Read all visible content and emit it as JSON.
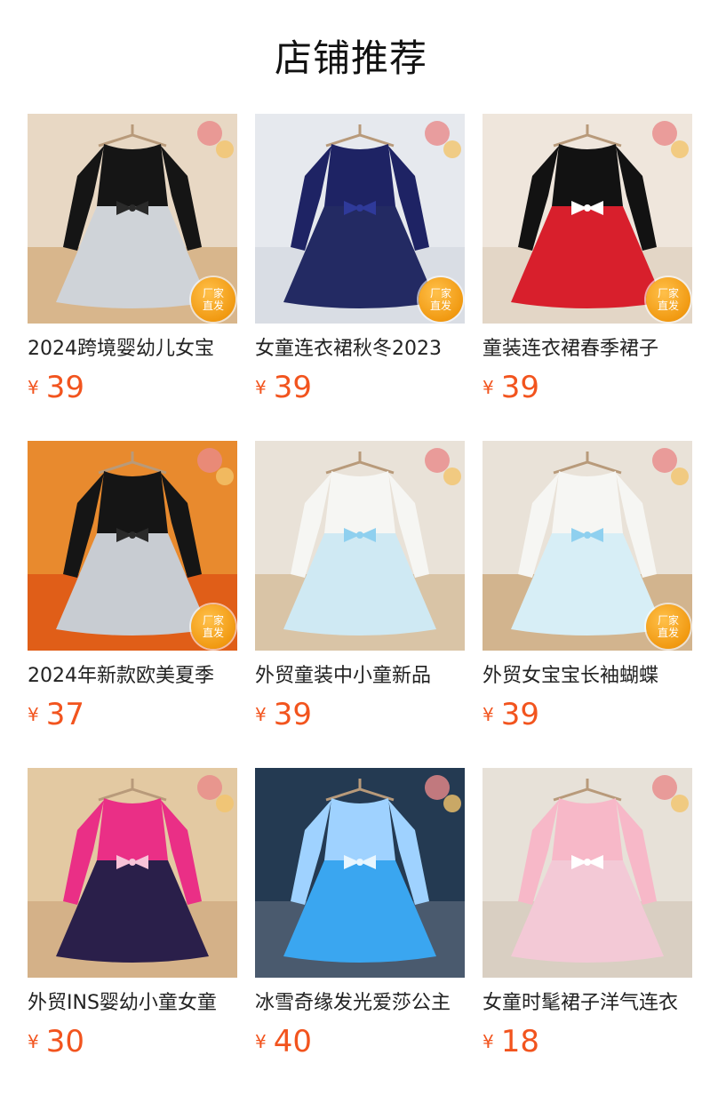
{
  "header": {
    "title": "店铺推荐"
  },
  "badge": {
    "line1": "厂家",
    "line2": "直发"
  },
  "currency": "¥",
  "products": [
    {
      "name": "2024跨境婴幼儿女宝",
      "price": "39",
      "badge": true,
      "bg": "#e8d8c4",
      "floor": "#d8b68c",
      "top": "#151515",
      "skirt": "#cfd3d8",
      "accent": "#2a2a2a"
    },
    {
      "name": "女童连衣裙秋冬2023",
      "price": "39",
      "badge": true,
      "bg": "#e6e9ee",
      "floor": "#d9dde4",
      "top": "#1e2364",
      "skirt": "#232a63",
      "accent": "#2f3a9a"
    },
    {
      "name": "童装连衣裙春季裙子",
      "price": "39",
      "badge": true,
      "bg": "#efe6dc",
      "floor": "#e3d6c6",
      "top": "#121212",
      "skirt": "#d81f2c",
      "accent": "#ffffff"
    },
    {
      "name": "2024年新款欧美夏季",
      "price": "37",
      "badge": true,
      "bg": "#e88a2e",
      "floor": "#e05e18",
      "top": "#151515",
      "skirt": "#c8ccd2",
      "accent": "#2a2a2a"
    },
    {
      "name": "外贸童装中小童新品",
      "price": "39",
      "badge": false,
      "bg": "#e9e2d8",
      "floor": "#d9c4a6",
      "top": "#f6f6f3",
      "skirt": "#cfe9f3",
      "accent": "#8fd0ef"
    },
    {
      "name": "外贸女宝宝长袖蝴蝶",
      "price": "39",
      "badge": true,
      "bg": "#e9e2d8",
      "floor": "#d2b48e",
      "top": "#f6f6f3",
      "skirt": "#d7eef6",
      "accent": "#8fd0ef"
    },
    {
      "name": "外贸INS婴幼小童女童",
      "price": "30",
      "badge": false,
      "bg": "#e3c9a2",
      "floor": "#d4b188",
      "top": "#ea2f86",
      "skirt": "#2a1f4a",
      "accent": "#f7c3d8"
    },
    {
      "name": "冰雪奇缘发光爱莎公主",
      "price": "40",
      "badge": false,
      "bg": "#243a52",
      "floor": "#4a5a6e",
      "top": "#9fd2ff",
      "skirt": "#3aa6f0",
      "accent": "#e8f6ff"
    },
    {
      "name": "女童时髦裙子洋气连衣",
      "price": "18",
      "badge": false,
      "bg": "#e7e1d8",
      "floor": "#d9cfc2",
      "top": "#f7b8c8",
      "skirt": "#f3c9d6",
      "accent": "#ffffff"
    }
  ]
}
